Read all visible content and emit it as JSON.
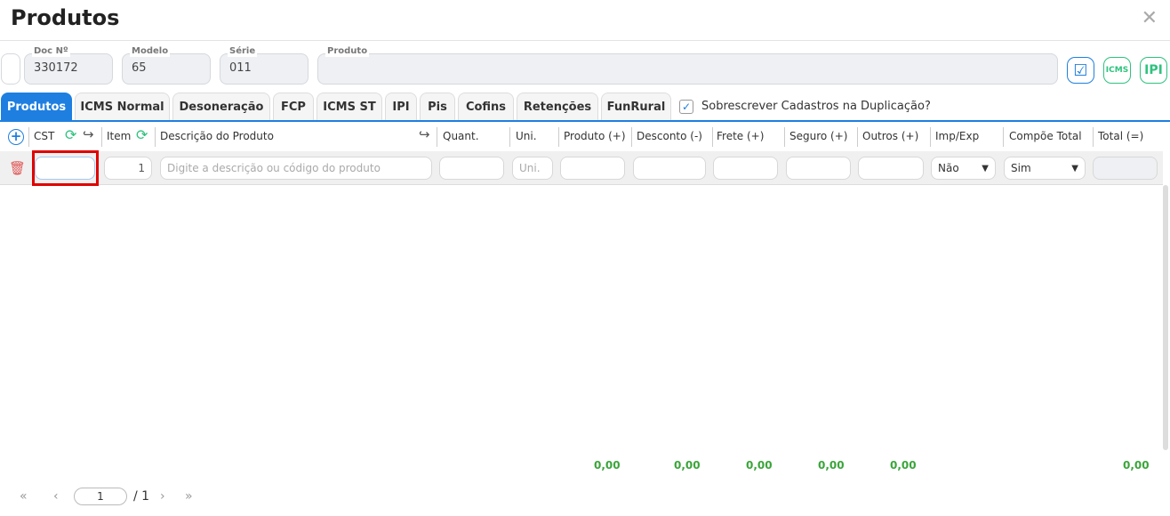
{
  "title": "Produtos",
  "header_fields": {
    "doc_label": "Doc Nº",
    "doc_value": "330172",
    "modelo_label": "Modelo",
    "modelo_value": "65",
    "serie_label": "Série",
    "serie_value": "011",
    "produto_label": "Produto",
    "produto_value": ""
  },
  "icon_buttons": {
    "icms": "ICMS",
    "ipi": "IPI"
  },
  "tabs": [
    "Produtos",
    "ICMS Normal",
    "Desoneração",
    "FCP",
    "ICMS ST",
    "IPI",
    "Pis",
    "Cofins",
    "Retenções",
    "FunRural"
  ],
  "overwrite_checkbox": {
    "label": "Sobrescrever Cadastros na Duplicação?",
    "checked": true
  },
  "columns": {
    "cst": "CST",
    "item": "Item",
    "descricao": "Descrição do Produto",
    "quant": "Quant.",
    "uni": "Uni.",
    "produto": "Produto (+)",
    "desconto": "Desconto (-)",
    "frete": "Frete (+)",
    "seguro": "Seguro (+)",
    "outros": "Outros (+)",
    "impexp": "Imp/Exp",
    "compoe": "Compõe Total",
    "total": "Total (=)"
  },
  "row": {
    "cst": "",
    "item": "1",
    "descricao_placeholder": "Digite a descrição ou código do produto",
    "uni_placeholder": "Uni.",
    "impexp": "Não",
    "compoe": "Sim"
  },
  "totals": {
    "produto": "0,00",
    "desconto": "0,00",
    "frete": "0,00",
    "seguro": "0,00",
    "outros": "0,00",
    "total": "0,00"
  },
  "pagination": {
    "page": "1",
    "of": "/ 1"
  },
  "colors": {
    "accent": "#1e7fe0",
    "green": "#2ec27e",
    "highlight": "#e00000"
  }
}
